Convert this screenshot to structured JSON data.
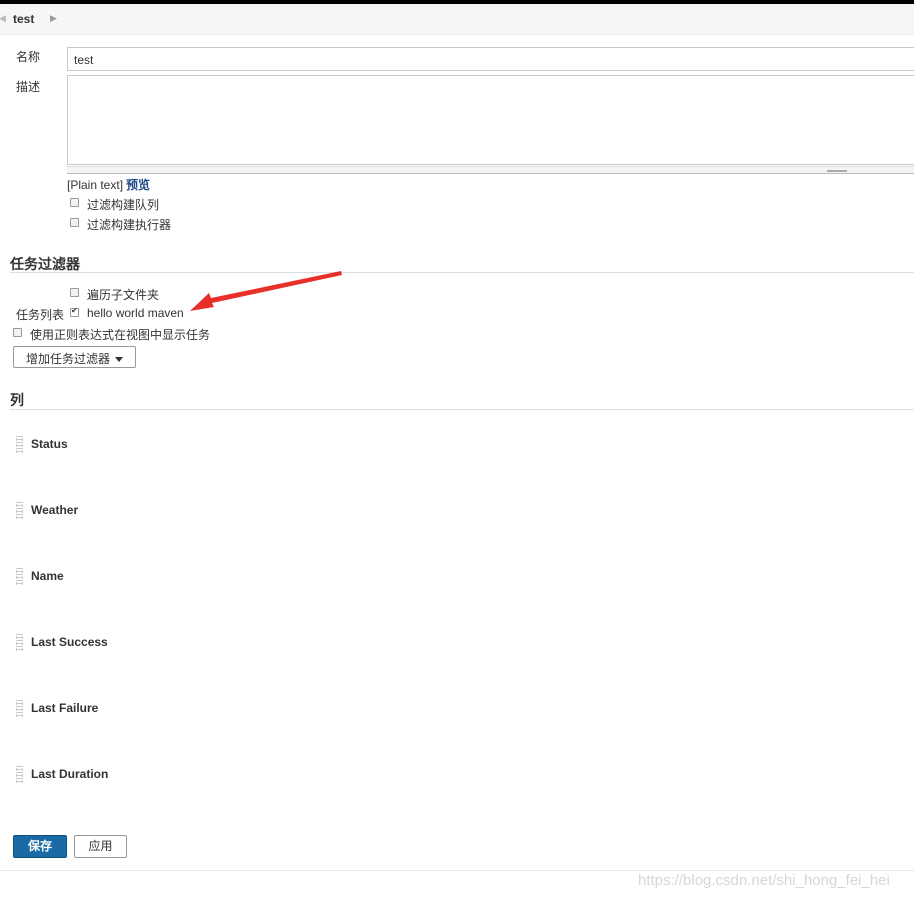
{
  "breadcrumb": {
    "item": "test"
  },
  "form": {
    "name_label": "名称",
    "name_value": "test",
    "description_label": "描述",
    "plain_text": "[Plain text]",
    "preview_link": "预览",
    "filter_queue_label": "过滤构建队列",
    "filter_executors_label": "过滤构建执行器"
  },
  "job_filters": {
    "title": "任务过滤器",
    "recurse_label": "遍历子文件夹",
    "jobs_label": "任务列表",
    "job_item": "hello world maven",
    "job_item_checked": true,
    "regex_label": "使用正则表达式在视图中显示任务",
    "add_filter_button": "增加任务过滤器"
  },
  "columns": {
    "title": "列",
    "items": [
      {
        "label": "Status"
      },
      {
        "label": "Weather"
      },
      {
        "label": "Name"
      },
      {
        "label": "Last Success"
      },
      {
        "label": "Last Failure"
      },
      {
        "label": "Last Duration"
      }
    ]
  },
  "buttons": {
    "save": "保存",
    "apply": "应用"
  },
  "watermark": "https://blog.csdn.net/shi_hong_fei_hei",
  "colors": {
    "primary_button": "#1a6aa6",
    "link": "#204a87",
    "annotation_arrow": "#e8302a"
  }
}
